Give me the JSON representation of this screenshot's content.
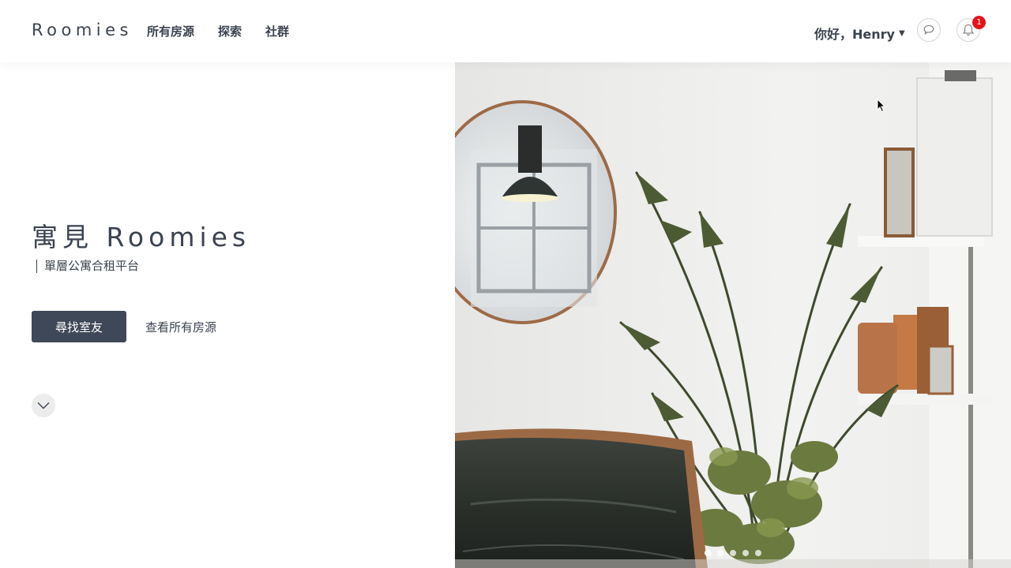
{
  "header": {
    "logo": "Roomies",
    "nav": [
      "所有房源",
      "探索",
      "社群"
    ],
    "greeting": "你好，Henry",
    "notification_count": "1"
  },
  "hero": {
    "title": "寓見 Roomies",
    "subtitle": "單層公寓合租平台",
    "primary_button": "尋找室友",
    "secondary_link": "查看所有房源"
  },
  "carousel": {
    "slides": 5,
    "active_index": 0
  },
  "colors": {
    "text": "#3b4350",
    "button": "#3e4858",
    "badge": "#e4141b"
  },
  "icons": [
    "chat-icon",
    "bell-icon",
    "chevron-down-icon",
    "caret-down-icon"
  ]
}
